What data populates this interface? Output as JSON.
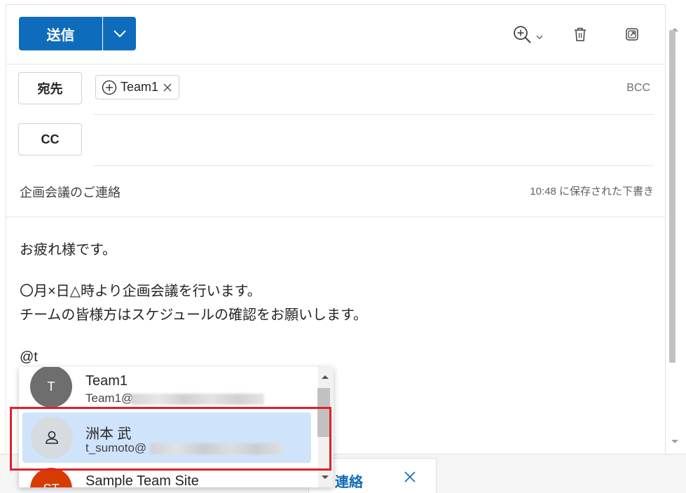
{
  "toolbar": {
    "send_label": "送信",
    "icons": [
      "chevron-down-icon",
      "zoom-in-icon",
      "trash-icon",
      "popout-icon"
    ]
  },
  "recipients": {
    "to_label": "宛先",
    "cc_label": "CC",
    "bcc_label": "BCC",
    "to_chips": [
      {
        "label": "Team1"
      }
    ]
  },
  "subject": "企画会議のご連絡",
  "saved_status": "10:48 に保存された下書き",
  "body": {
    "line1": "お疲れ様です。",
    "line2": "〇月×日△時より企画会議を行います。",
    "line3": "チームの皆様方はスケジュールの確認をお願いします。",
    "mention_input": "@t"
  },
  "mention_suggestions": [
    {
      "initials": "T",
      "name": "Team1",
      "email": "Team1@",
      "avatar_color": "#6e6e6e"
    },
    {
      "initials": "",
      "name": "洲本 武",
      "email": "t_sumoto@",
      "avatar_color": "#d6dbe0",
      "selected": true
    },
    {
      "initials": "ST",
      "name": "Sample Team Site",
      "email": "",
      "avatar_color": "#d83b01"
    }
  ],
  "bottom_tab": {
    "label": "連絡"
  },
  "colors": {
    "accent": "#0f6cbd",
    "highlight": "#e0202a",
    "selection": "#cfe4fa"
  }
}
